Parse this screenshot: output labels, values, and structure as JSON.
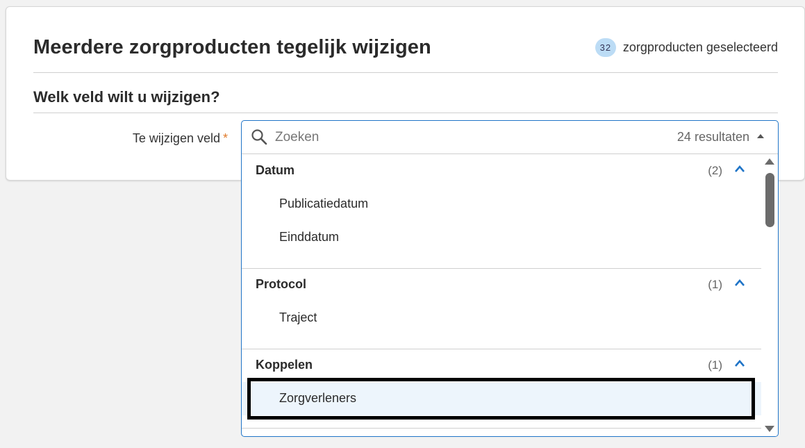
{
  "header": {
    "title": "Meerdere zorgproducten tegelijk wijzigen",
    "selected_count": "32",
    "selected_label": "zorgproducten geselecteerd"
  },
  "section": {
    "title": "Welk veld wilt u wijzigen?"
  },
  "field": {
    "label": "Te wijzigen veld",
    "required_mark": "*"
  },
  "dropdown": {
    "search_placeholder": "Zoeken",
    "search_value": "",
    "results": "24 resultaten",
    "groups": [
      {
        "name": "Datum",
        "count": "(2)",
        "options": [
          "Publicatiedatum",
          "Einddatum"
        ]
      },
      {
        "name": "Protocol",
        "count": "(1)",
        "options": [
          "Traject"
        ]
      },
      {
        "name": "Koppelen",
        "count": "(1)",
        "options": [
          "Zorgverleners"
        ]
      }
    ],
    "highlighted_option": "Zorgverleners"
  },
  "colors": {
    "accent": "#1f74c7",
    "badge": "#bcdcf5",
    "required": "#e07b2c",
    "highlight": "#edf5fc"
  },
  "icons": {
    "search": "search-icon",
    "group_toggle": "chevron-up-icon",
    "dropdown_toggle": "caret-up-icon"
  }
}
